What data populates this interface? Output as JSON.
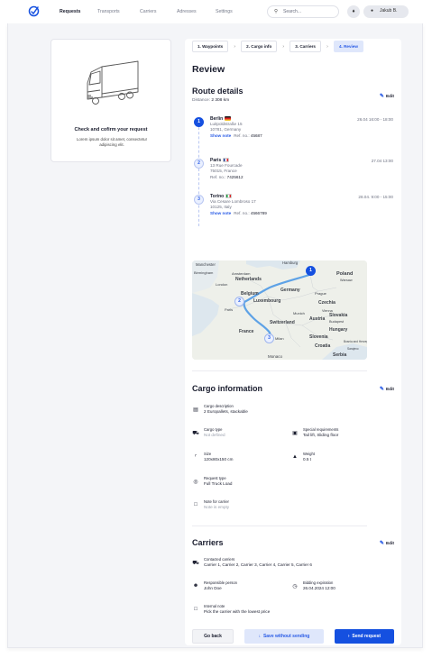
{
  "nav": {
    "items": [
      "Requests",
      "Transports",
      "Carriers",
      "Adresses",
      "Settings"
    ],
    "search_placeholder": "Search...",
    "user_name": "Jakub B."
  },
  "left_card": {
    "title": "Check and cofirm your request",
    "text": "Lorem ipsum dolor sit amet, consectetur adipiscing elit."
  },
  "steps": [
    "1. Waypoints",
    "2. Cargo info",
    "3. Carriers",
    "4. Review"
  ],
  "page_title": "Review",
  "route": {
    "heading": "Route details",
    "edit_label": "Edit",
    "distance_label": "Distance:",
    "distance_value": "2 308 km",
    "waypoints": [
      {
        "num": "1",
        "city": "Berlin",
        "street": "Luitpoldstraße 15",
        "zip": "10781, Germany",
        "note_link": "Show note",
        "ref_label": "Ref. no.:",
        "ref": "45687",
        "date": "26.04 16:00 - 18:00"
      },
      {
        "num": "2",
        "city": "Paris",
        "street": "13 Rue Fourcade",
        "zip": "75015,  France",
        "note_link": "",
        "ref_label": "Ref. no.:",
        "ref": "7425612",
        "date": "27.04 13:00"
      },
      {
        "num": "3",
        "city": "Torino",
        "street": "Via Cesare Lombroso 17",
        "zip": "10125, Italy",
        "note_link": "Show note",
        "ref_label": "Ref. no.:",
        "ref": "4566789",
        "date": "28.04. 9:00 - 15:00"
      }
    ],
    "map_labels": [
      "Manchester",
      "Hamburg",
      "Birmingham",
      "Amsterdam",
      "Netherlands",
      "Poland",
      "Warsaw",
      "London",
      "Germany",
      "Belgium",
      "Prague",
      "Luxembourg",
      "Czechia",
      "Paris",
      "Munich",
      "Vienna",
      "Slovakia",
      "Austria",
      "Budapest",
      "Switzerland",
      "Hungary",
      "France",
      "Milan",
      "Slovenia",
      "Croatia",
      "Bosnia and Herzegovina",
      "Sarajevo",
      "Serbia",
      "Monaco"
    ],
    "map_pins": [
      "1",
      "2",
      "3"
    ]
  },
  "cargo": {
    "heading": "Cargo information",
    "edit_label": "Edit",
    "description_label": "Cargo description",
    "description": "2 Europallets, stackable",
    "type_label": "Cargo type",
    "type": "Not defined",
    "special_label": "Special requirements",
    "special": "Tail lift, Sliding floor",
    "size_label": "Size",
    "size": "120x80x150 cm",
    "weight_label": "Weight",
    "weight": "0.5 t",
    "request_type_label": "Request type",
    "request_type": "Full Truck Load",
    "note_label": "Note for carrier",
    "note": "Note is empty"
  },
  "carriers": {
    "heading": "Carriers",
    "edit_label": "Edit",
    "contacted_label": "Contacted carriers",
    "contacted": "Carrier 1, Carrier 2, Carrier 3, Carrier 4, Carrier 5,  Carrier 6",
    "responsible_label": "Responsible person",
    "responsible": "John Doe",
    "bidding_label": "Bidding expiration",
    "bidding": "26.04.2024 12:00",
    "internal_label": "Internal note",
    "internal": "Pick the carrier with the lowest price"
  },
  "buttons": {
    "back": "Go back",
    "save": "Save without sending",
    "send": "Send request"
  },
  "colors": {
    "accent": "#1550e0",
    "accent_light": "#dfe7fb",
    "background": "#f4f5f8"
  }
}
